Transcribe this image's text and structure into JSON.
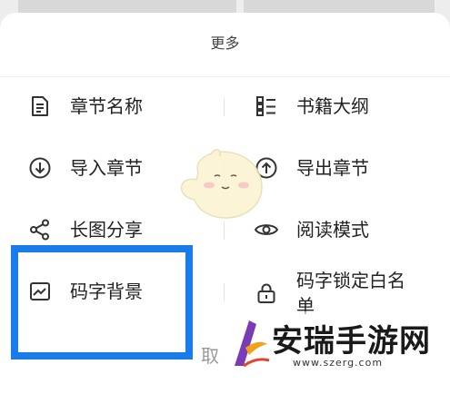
{
  "sheet": {
    "title": "更多"
  },
  "menu": {
    "left": [
      {
        "label": "章节名称",
        "icon": "document-icon"
      },
      {
        "label": "导入章节",
        "icon": "import-icon"
      },
      {
        "label": "长图分享",
        "icon": "share-icon"
      },
      {
        "label": "码字背景",
        "icon": "background-image-icon"
      }
    ],
    "right": [
      {
        "label": "书籍大纲",
        "icon": "outline-list-icon"
      },
      {
        "label": "导出章节",
        "icon": "export-icon"
      },
      {
        "label": "阅读模式",
        "icon": "eye-icon"
      },
      {
        "label": "码字锁定白名单",
        "icon": "lock-icon"
      }
    ]
  },
  "footer": {
    "cancel_label": "取"
  },
  "watermark": {
    "text": "安瑞手游网",
    "url": "www.szerg.com"
  },
  "colors": {
    "highlight": "#1a7ce8",
    "icon": "#333333"
  }
}
